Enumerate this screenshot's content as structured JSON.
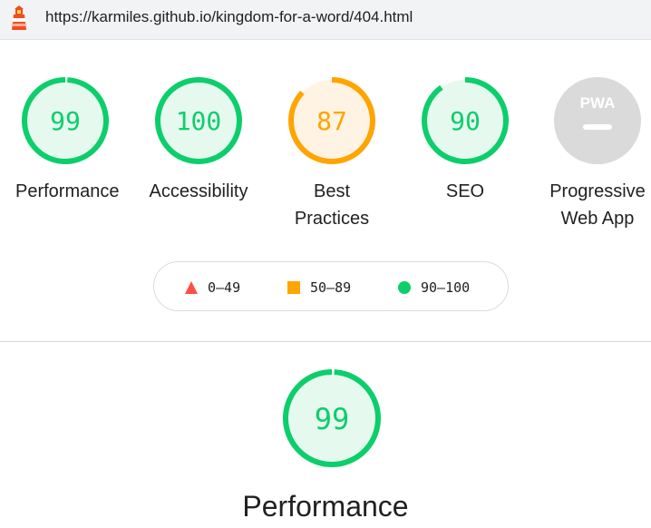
{
  "address_bar": {
    "url": "https://karmiles.github.io/kingdom-for-a-word/404.html",
    "icon": "lighthouse-icon"
  },
  "gauges": [
    {
      "name": "performance",
      "score": "99",
      "value": 0.99,
      "label": "Performance",
      "color": "#0cce6b",
      "bg": "#e6f9ef"
    },
    {
      "name": "accessibility",
      "score": "100",
      "value": 1.0,
      "label": "Accessibility",
      "color": "#0cce6b",
      "bg": "#e6f9ef"
    },
    {
      "name": "best-practices",
      "score": "87",
      "value": 0.87,
      "label_line1": "Best",
      "label_line2": "Practices",
      "color": "#ffa400",
      "bg": "#fff4e3"
    },
    {
      "name": "seo",
      "score": "90",
      "value": 0.9,
      "label": "SEO",
      "color": "#0cce6b",
      "bg": "#e6f9ef"
    },
    {
      "name": "pwa",
      "badge_text": "PWA",
      "label_line1": "Progressive",
      "label_line2": "Web App",
      "color": "#cccccc"
    }
  ],
  "legend": {
    "fail": {
      "range": "0–49",
      "color": "#ff4e42",
      "icon": "triangle-icon"
    },
    "average": {
      "range": "50–89",
      "color": "#ffa400",
      "icon": "square-icon"
    },
    "pass": {
      "range": "90–100",
      "color": "#0cce6b",
      "icon": "circle-icon"
    }
  },
  "section": {
    "score": "99",
    "value": 0.99,
    "title": "Performance",
    "color": "#0cce6b",
    "bg": "#e6f9ef"
  }
}
